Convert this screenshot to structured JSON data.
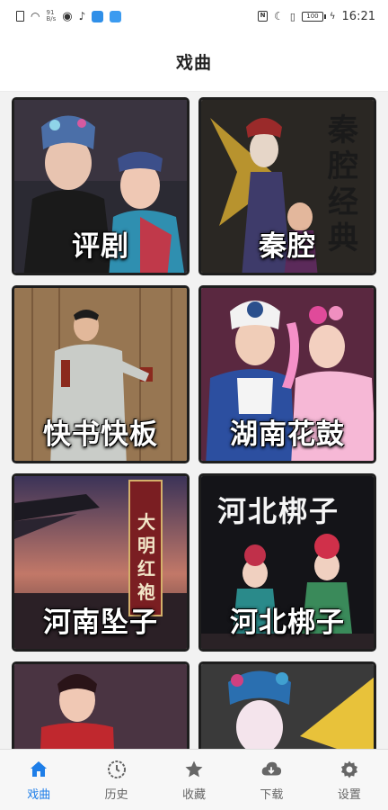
{
  "status_bar": {
    "net_speed_value": "91",
    "net_speed_unit": "B/s",
    "battery": "100",
    "time": "16:21"
  },
  "app_bar": {
    "title": "戏曲"
  },
  "cards": [
    {
      "label": "评剧"
    },
    {
      "label": "秦腔",
      "art_text": "秦腔经典"
    },
    {
      "label": "快书快板"
    },
    {
      "label": "湖南花鼓"
    },
    {
      "label": "河南坠子",
      "art_text": "大明红袍"
    },
    {
      "label": "河北梆子",
      "art_text": "河北梆子"
    },
    {
      "label": ""
    },
    {
      "label": ""
    }
  ],
  "bottom_nav": {
    "items": [
      {
        "label": "戏曲",
        "icon": "home-icon",
        "active": true
      },
      {
        "label": "历史",
        "icon": "clock-icon",
        "active": false
      },
      {
        "label": "收藏",
        "icon": "star-icon",
        "active": false
      },
      {
        "label": "下载",
        "icon": "cloud-download-icon",
        "active": false
      },
      {
        "label": "设置",
        "icon": "gear-icon",
        "active": false
      }
    ],
    "active_color": "#1e7ee8",
    "inactive_color": "#666666"
  }
}
